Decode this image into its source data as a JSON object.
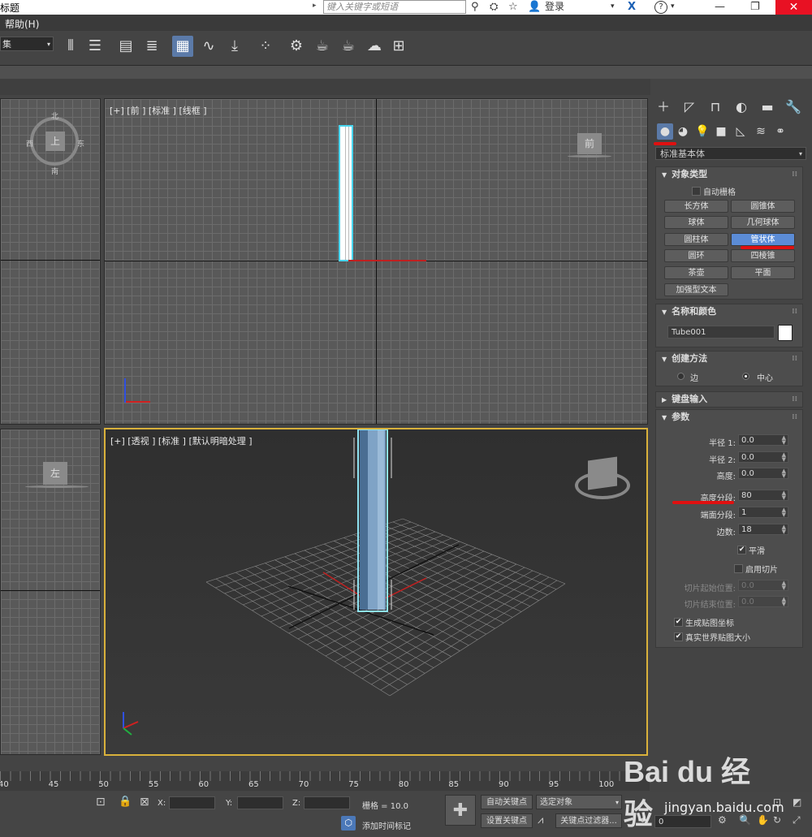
{
  "window": {
    "title_fragment": "标题",
    "search_placeholder": "键入关键字或短语",
    "login": "登录",
    "help_icon": "?",
    "close": "✕"
  },
  "menu": {
    "help": "帮助(H)"
  },
  "toolbar": {
    "selection_set": "集"
  },
  "viewports": {
    "front": "[+] [前 ] [标准 ] [线框 ]",
    "perspective": "[+] [透视 ] [标准 ] [默认明暗处理 ]",
    "top_cube": "上",
    "top_cube_w": "西",
    "top_cube_e": "东",
    "top_cube_s": "南",
    "top_cube_n": "北",
    "front_cube": "前",
    "left_cube": "左"
  },
  "panel": {
    "category": "标准基本体",
    "object_type": {
      "title": "对象类型",
      "autogrid": "自动栅格",
      "buttons": [
        "长方体",
        "圆锥体",
        "球体",
        "几何球体",
        "圆柱体",
        "管状体",
        "圆环",
        "四棱锥",
        "茶壶",
        "平面",
        "加强型文本"
      ],
      "selected": "管状体"
    },
    "name_color": {
      "title": "名称和颜色",
      "name": "Tube001"
    },
    "creation": {
      "title": "创建方法",
      "edge": "边",
      "center": "中心"
    },
    "keyboard": {
      "title": "键盘输入"
    },
    "params": {
      "title": "参数",
      "radius1_label": "半径 1:",
      "radius1": "0.0",
      "radius2_label": "半径 2:",
      "radius2": "0.0",
      "height_label": "高度:",
      "height": "0.0",
      "height_segs_label": "高度分段:",
      "height_segs": "80",
      "cap_segs_label": "端面分段:",
      "cap_segs": "1",
      "sides_label": "边数:",
      "sides": "18",
      "smooth": "平滑",
      "slice_on": "启用切片",
      "slice_from_label": "切片起始位置:",
      "slice_from": "0.0",
      "slice_to_label": "切片结束位置:",
      "slice_to": "0.0",
      "gen_map": "生成贴图坐标",
      "real_world": "真实世界贴图大小"
    }
  },
  "timeline": {
    "ticks": [
      "40",
      "45",
      "50",
      "55",
      "60",
      "65",
      "70",
      "75",
      "80",
      "85",
      "90",
      "95",
      "100"
    ]
  },
  "status": {
    "x": "X:",
    "y": "Y:",
    "z": "Z:",
    "grid": "栅格 = 10.0",
    "add_time_tag": "添加时间标记",
    "auto_key": "自动关键点",
    "selected_obj": "选定对象",
    "set_key": "设置关键点",
    "key_filters": "关键点过滤器...",
    "frame": "0"
  },
  "watermark": {
    "brand": "Bai du 经验",
    "url": "jingyan.baidu.com"
  }
}
